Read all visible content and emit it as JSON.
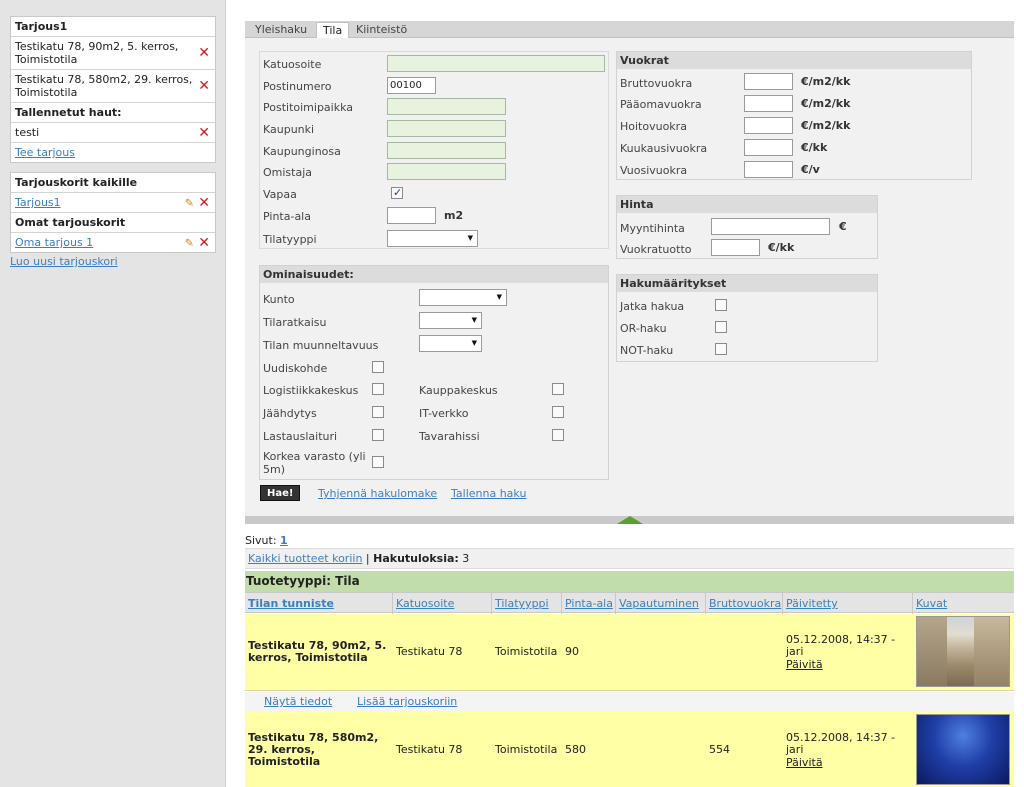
{
  "sidebar": {
    "offer": {
      "title": "Tarjous1",
      "items": [
        {
          "label": "Testikatu 78, 90m2, 5. kerros, Toimistotila"
        },
        {
          "label": "Testikatu 78, 580m2, 29. kerros, Toimistotila"
        }
      ],
      "saved_title": "Tallennetut haut:",
      "saved": [
        {
          "label": "testi"
        }
      ],
      "make_offer": "Tee tarjous"
    },
    "baskets": {
      "all_title": "Tarjouskorit kaikille",
      "all_items": [
        {
          "label": "Tarjous1"
        }
      ],
      "own_title": "Omat tarjouskorit",
      "own_items": [
        {
          "label": "Oma tarjous 1"
        }
      ],
      "new_basket": "Luo uusi tarjouskori"
    }
  },
  "tabs": [
    {
      "label": "Yleishaku",
      "active": false
    },
    {
      "label": "Tila",
      "active": true
    },
    {
      "label": "Kiinteistö",
      "active": false
    }
  ],
  "form": {
    "address": {
      "label": "Katuosoite",
      "value": ""
    },
    "postal_code": {
      "label": "Postinumero",
      "value": "00100"
    },
    "postal_city": {
      "label": "Postitoimipaikka",
      "value": ""
    },
    "city": {
      "label": "Kaupunki",
      "value": ""
    },
    "district": {
      "label": "Kaupunginosa",
      "value": ""
    },
    "owner": {
      "label": "Omistaja",
      "value": ""
    },
    "vacant": {
      "label": "Vapaa",
      "checked": true
    },
    "area": {
      "label": "Pinta-ala",
      "unit": "m2",
      "value": ""
    },
    "space_type": {
      "label": "Tilatyyppi",
      "value": ""
    },
    "properties": {
      "title": "Ominaisuudet:",
      "condition": "Kunto",
      "layout": "Tilaratkaisu",
      "flexibility": "Tilan muunneltavuus",
      "new_building": "Uudiskohde",
      "logistics": "Logistiikkakeskus",
      "mall": "Kauppakeskus",
      "cooling": "Jäähdytys",
      "it_network": "IT-verkko",
      "loading_dock": "Lastauslaituri",
      "goods_lift": "Tavarahissi",
      "high_storage": "Korkea varasto (yli 5m)"
    },
    "rents": {
      "title": "Vuokrat",
      "rows": [
        {
          "label": "Bruttovuokra",
          "unit": "€/m2/kk"
        },
        {
          "label": "Pääomavuokra",
          "unit": "€/m2/kk"
        },
        {
          "label": "Hoitovuokra",
          "unit": "€/m2/kk"
        },
        {
          "label": "Kuukausivuokra",
          "unit": "€/kk"
        },
        {
          "label": "Vuosivuokra",
          "unit": "€/v"
        }
      ]
    },
    "price": {
      "title": "Hinta",
      "sale_label": "Myyntihinta",
      "sale_unit": "€",
      "yield_label": "Vuokratuotto",
      "yield_unit": "€/kk"
    },
    "search_defs": {
      "title": "Hakumääritykset",
      "continue": "Jatka hakua",
      "or": "OR-haku",
      "not": "NOT-haku"
    },
    "buttons": {
      "search": "Hae!",
      "clear": "Tyhjennä hakulomake",
      "save": "Tallenna haku"
    }
  },
  "results": {
    "pages_label": "Sivut:",
    "page": "1",
    "add_all": "Kaikki tuotteet koriin",
    "separator": "|",
    "count_label": "Hakutuloksia:",
    "count": "3",
    "group_title": "Tuotetyyppi: Tila",
    "columns": [
      "Tilan tunniste",
      "Katuosoite",
      "Tilatyyppi",
      "Pinta-ala",
      "Vapautuminen",
      "Bruttovuokra",
      "Päivitetty",
      "Kuvat"
    ],
    "rows": [
      {
        "id": "Testikatu 78, 90m2, 5. kerros, Toimistotila",
        "address": "Testikatu 78",
        "type": "Toimistotila",
        "area": "90",
        "vacancy": "",
        "gross_rent": "",
        "updated": "05.12.2008, 14:37 - jari",
        "update_link": "Päivitä"
      },
      {
        "id": "Testikatu 78, 580m2, 29. kerros, Toimistotila",
        "address": "Testikatu 78",
        "type": "Toimistotila",
        "area": "580",
        "vacancy": "",
        "gross_rent": "554",
        "updated": "05.12.2008, 14:37 - jari",
        "update_link": "Päivitä"
      }
    ],
    "row_actions": {
      "show": "Näytä tiedot",
      "add": "Lisää tarjouskoriin"
    }
  }
}
